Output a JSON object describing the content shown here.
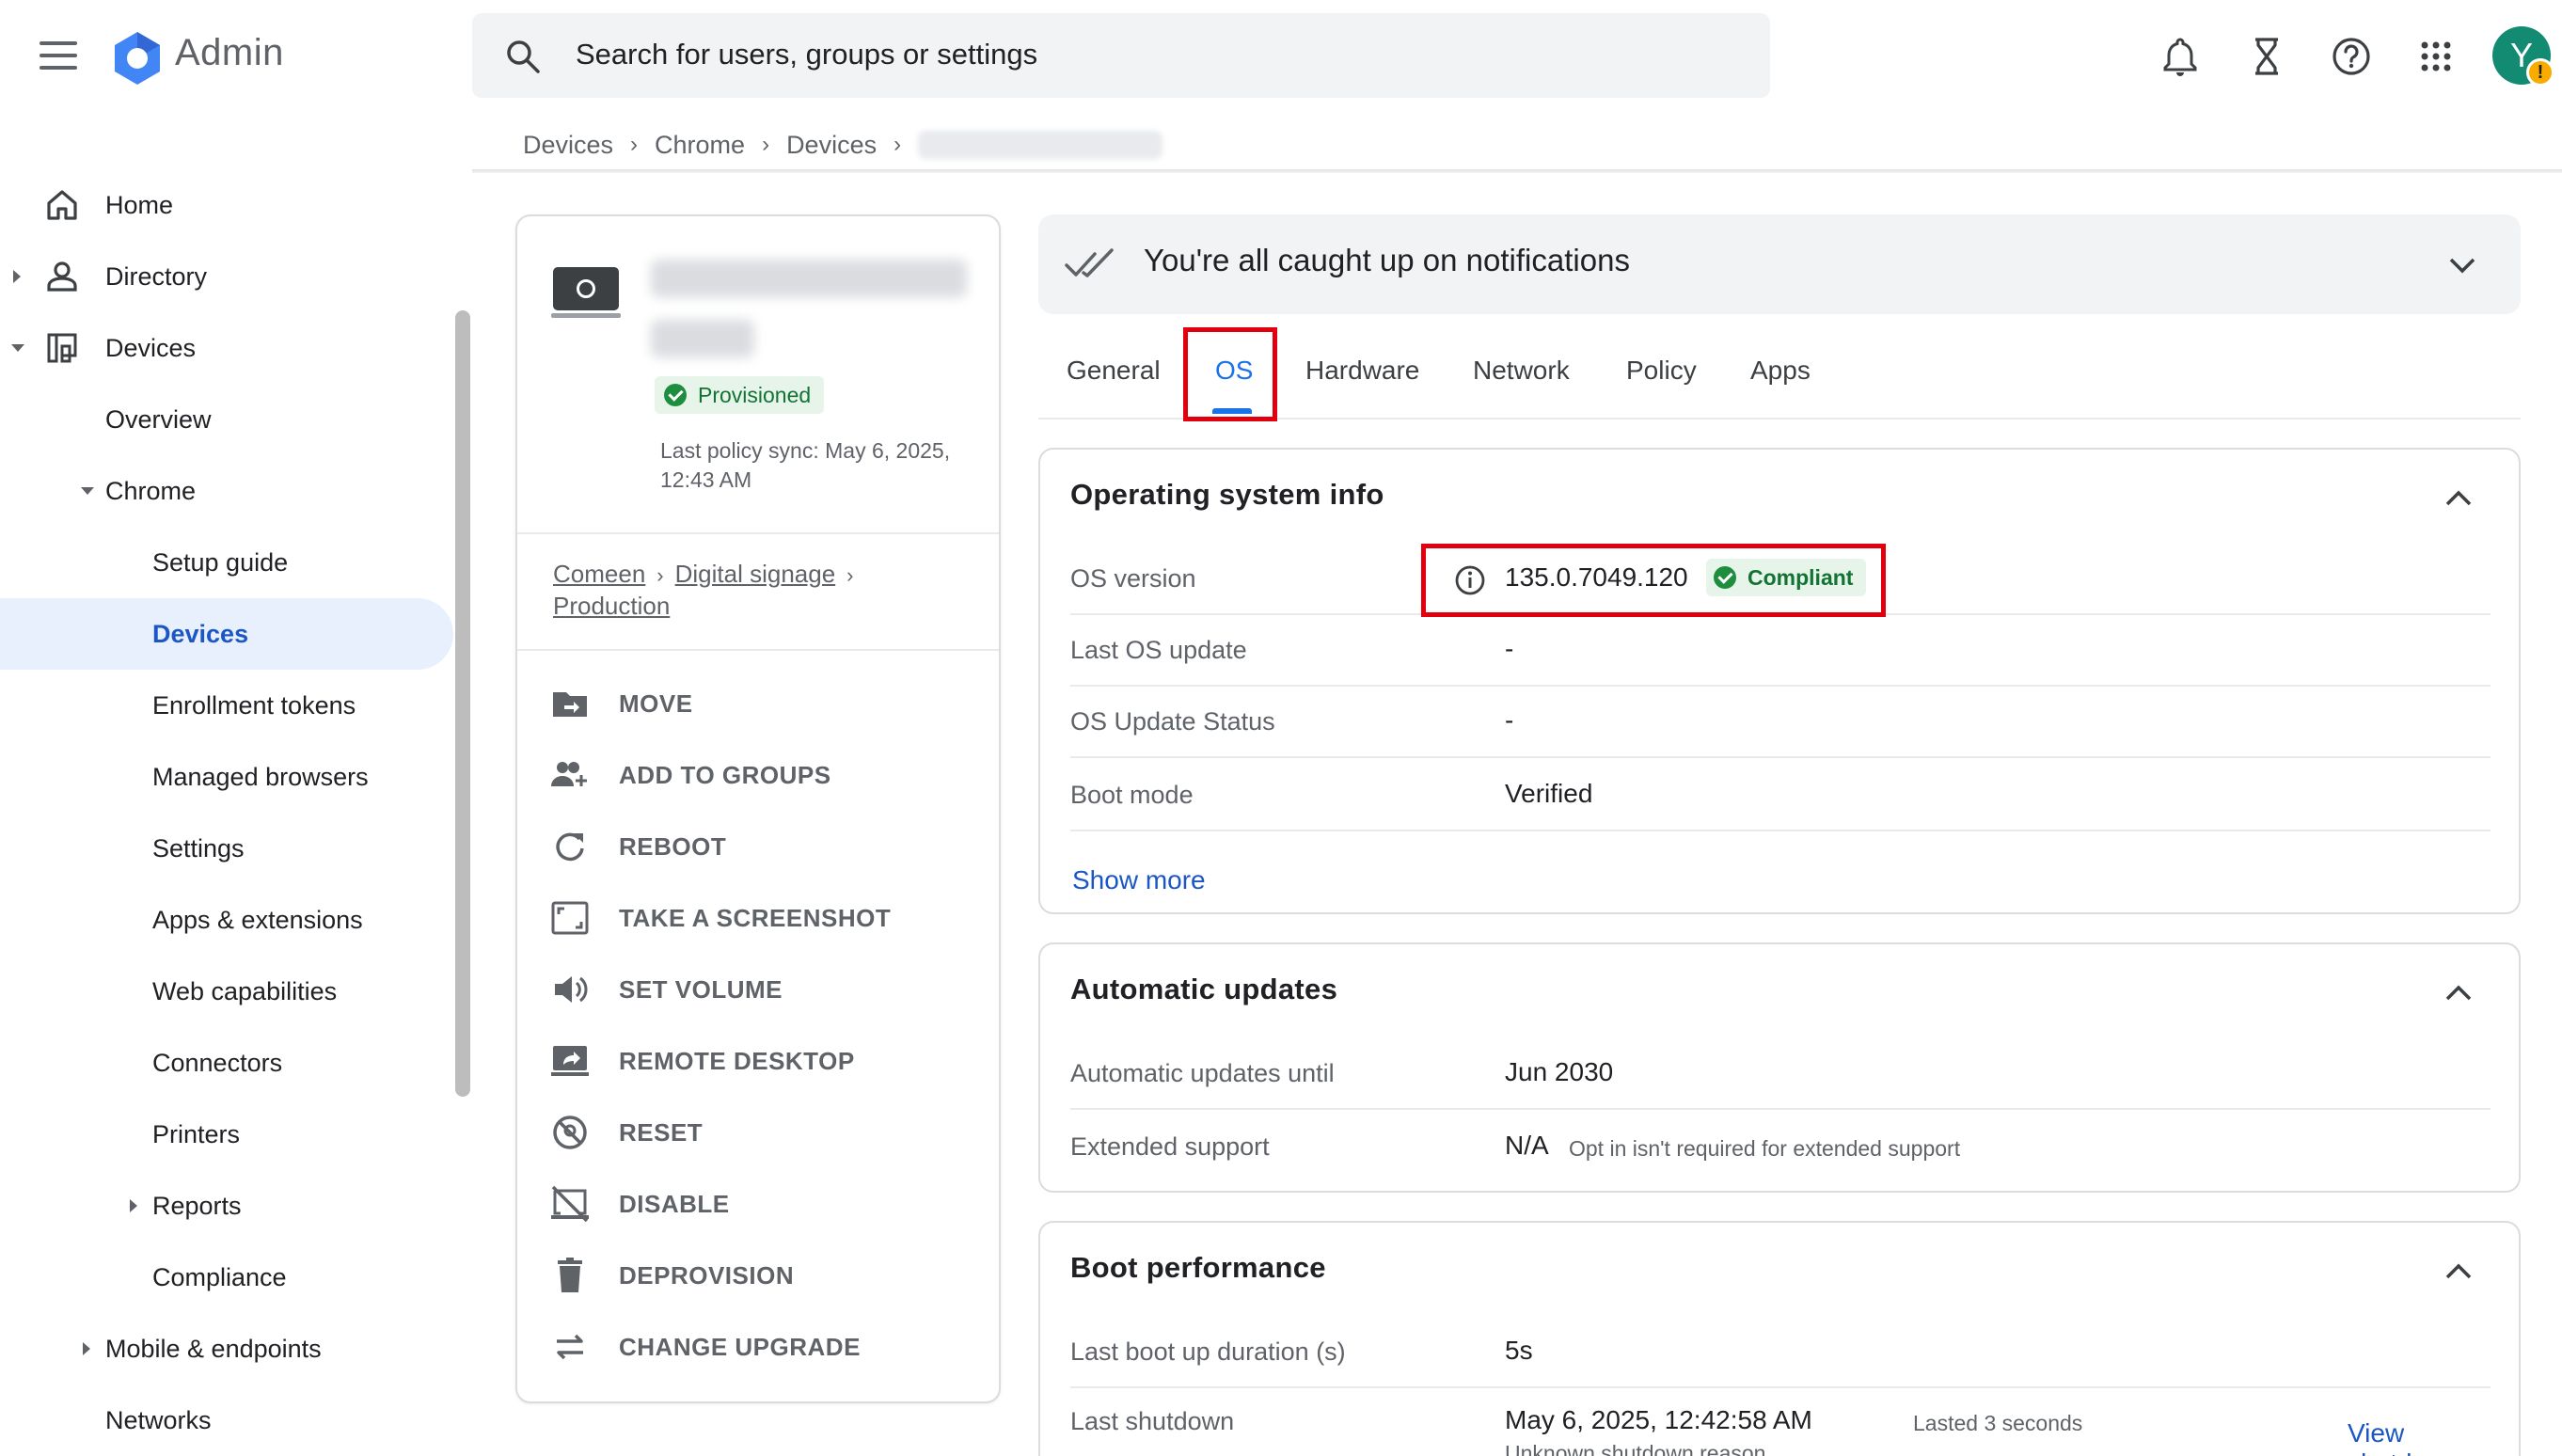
{
  "header": {
    "app_title": "Admin",
    "search_placeholder": "Search for users, groups or settings",
    "avatar_letter": "Y",
    "avatar_badge": "!",
    "colors": {
      "accent": "#1a73e8",
      "logo_blue": "#4285f4",
      "avatar": "#138a72",
      "alert": "#e2000f"
    }
  },
  "breadcrumb": [
    "Devices",
    "Chrome",
    "Devices"
  ],
  "sidebar": {
    "items": [
      {
        "label": "Home"
      },
      {
        "label": "Directory"
      },
      {
        "label": "Devices"
      },
      {
        "label": "Overview"
      },
      {
        "label": "Chrome"
      },
      {
        "label": "Setup guide"
      },
      {
        "label": "Devices"
      },
      {
        "label": "Enrollment tokens"
      },
      {
        "label": "Managed browsers"
      },
      {
        "label": "Settings"
      },
      {
        "label": "Apps & extensions"
      },
      {
        "label": "Web capabilities"
      },
      {
        "label": "Connectors"
      },
      {
        "label": "Printers"
      },
      {
        "label": "Reports"
      },
      {
        "label": "Compliance"
      },
      {
        "label": "Mobile & endpoints"
      },
      {
        "label": "Networks"
      }
    ]
  },
  "device": {
    "status": "Provisioned",
    "last_sync": "Last policy sync: May 6, 2025, 12:43 AM",
    "ou_path": [
      "Comeen",
      "Digital signage",
      "Production"
    ],
    "actions": [
      {
        "label": "MOVE",
        "icon": "move-folder-icon"
      },
      {
        "label": "ADD TO GROUPS",
        "icon": "add-group-icon"
      },
      {
        "label": "REBOOT",
        "icon": "reboot-icon"
      },
      {
        "label": "TAKE A SCREENSHOT",
        "icon": "screenshot-icon"
      },
      {
        "label": "SET VOLUME",
        "icon": "volume-icon"
      },
      {
        "label": "REMOTE DESKTOP",
        "icon": "remote-desktop-icon"
      },
      {
        "label": "RESET",
        "icon": "reset-icon"
      },
      {
        "label": "DISABLE",
        "icon": "disable-icon"
      },
      {
        "label": "DEPROVISION",
        "icon": "trash-icon"
      },
      {
        "label": "CHANGE UPGRADE",
        "icon": "swap-icon"
      }
    ]
  },
  "notification": {
    "text": "You're all caught up on notifications"
  },
  "tabs": [
    "General",
    "OS",
    "Hardware",
    "Network",
    "Policy",
    "Apps"
  ],
  "os_info": {
    "title": "Operating system info",
    "rows": [
      {
        "label": "OS version",
        "value": "135.0.7049.120",
        "badge": "Compliant"
      },
      {
        "label": "Last OS update",
        "value": "-"
      },
      {
        "label": "OS Update Status",
        "value": "-"
      },
      {
        "label": "Boot mode",
        "value": "Verified"
      }
    ],
    "show_more": "Show more"
  },
  "auto_updates": {
    "title": "Automatic updates",
    "rows": [
      {
        "label": "Automatic updates until",
        "value": "Jun 2030"
      },
      {
        "label": "Extended support",
        "value": "N/A",
        "note": "Opt in isn't required for extended support"
      }
    ]
  },
  "boot_perf": {
    "title": "Boot performance",
    "rows": [
      {
        "label": "Last boot up duration (s)",
        "value": "5s"
      },
      {
        "label": "Last shutdown",
        "value": "May 6, 2025, 12:42:58 AM",
        "note": "Lasted 3 seconds",
        "sub": "Unknown shutdown reason"
      }
    ],
    "view_link": "View shutdowns"
  }
}
